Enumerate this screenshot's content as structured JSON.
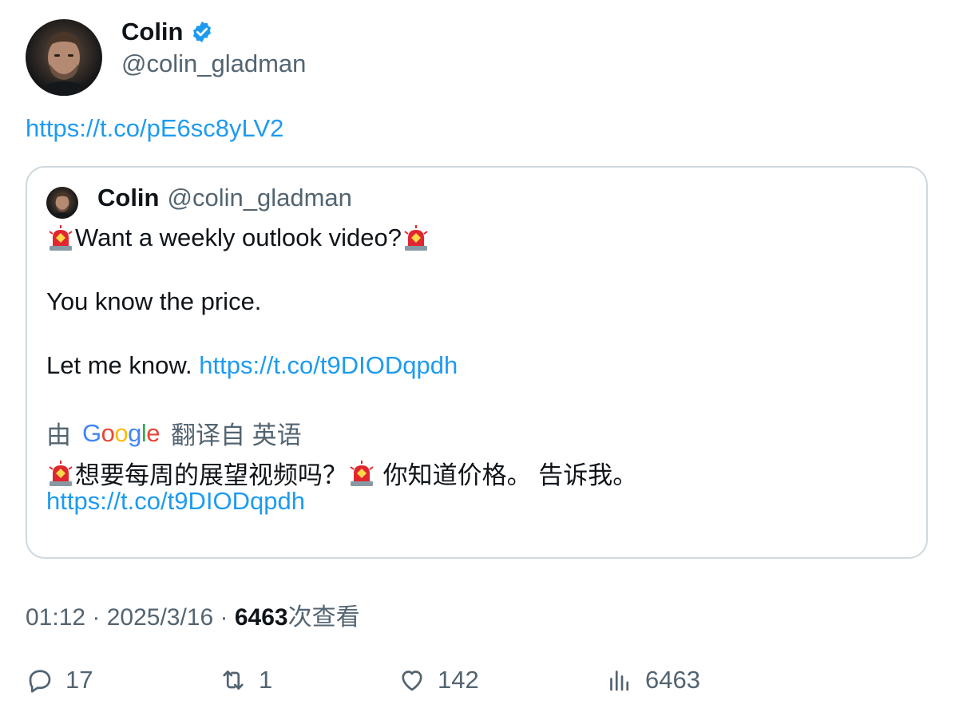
{
  "author": {
    "name": "Colin",
    "handle": "@colin_gladman",
    "verified": true
  },
  "tweet": {
    "link": "https://t.co/pE6sc8yLV2"
  },
  "quoted": {
    "name": "Colin",
    "handle": "@colin_gladman",
    "line1": "Want a weekly outlook video?",
    "line2": "You know the price.",
    "line3_text": "Let me know. ",
    "line3_link": "https://t.co/t9DIODqpdh",
    "translate": {
      "by": "由",
      "brand": "Google",
      "from": "翻译自 英语",
      "text_a": "想要每周的展望视频吗？",
      "text_b": " 你知道价格。 告诉我。",
      "link": "https://t.co/t9DIODqpdh"
    }
  },
  "meta": {
    "time_date": "01:12 · 2025/3/16 · ",
    "views": "6463",
    "views_label": "次查看"
  },
  "actions": {
    "replies": "17",
    "reposts": "1",
    "likes": "142",
    "views": "6463"
  },
  "colors": {
    "link": "#1d9bf0",
    "verified": "#1d9bf0",
    "muted": "#536471",
    "border": "#cfd9de"
  }
}
